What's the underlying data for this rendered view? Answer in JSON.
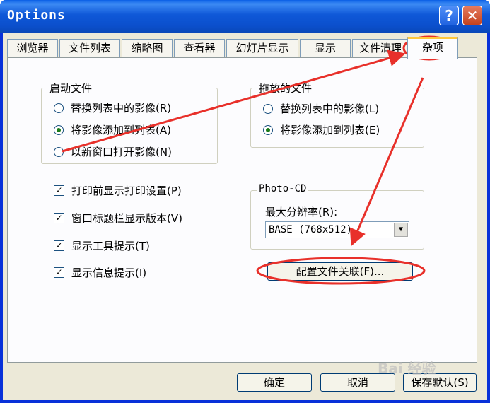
{
  "window": {
    "title": "Options",
    "help_label": "?",
    "close_label": "✕"
  },
  "tabs": [
    {
      "label": "浏览器"
    },
    {
      "label": "文件列表"
    },
    {
      "label": "缩略图"
    },
    {
      "label": "查看器"
    },
    {
      "label": "幻灯片显示"
    },
    {
      "label": "显示"
    },
    {
      "label": "文件清理"
    },
    {
      "label": "杂项",
      "active": true
    }
  ],
  "startup_group": {
    "legend": "启动文件",
    "options": [
      {
        "label": "替换列表中的影像(R)",
        "selected": false
      },
      {
        "label": "将影像添加到列表(A)",
        "selected": true
      },
      {
        "label": "以新窗口打开影像(N)",
        "selected": false
      }
    ]
  },
  "drop_group": {
    "legend": "拖放的文件",
    "options": [
      {
        "label": "替换列表中的影像(L)",
        "selected": false
      },
      {
        "label": "将影像添加到列表(E)",
        "selected": true
      }
    ]
  },
  "checkboxes": [
    {
      "label": "打印前显示打印设置(P)",
      "checked": true
    },
    {
      "label": "窗口标题栏显示版本(V)",
      "checked": true
    },
    {
      "label": "显示工具提示(T)",
      "checked": true
    },
    {
      "label": "显示信息提示(I)",
      "checked": true
    }
  ],
  "photo_cd": {
    "legend": "Photo-CD",
    "resolution_label": "最大分辨率(R):",
    "resolution_value": "BASE (768x512)"
  },
  "file_assoc_button": "配置文件关联(F)...",
  "footer": {
    "ok": "确定",
    "cancel": "取消",
    "save_default": "保存默认(S)"
  },
  "annotation_color": "#e8302a",
  "watermark": "Bai 经验"
}
